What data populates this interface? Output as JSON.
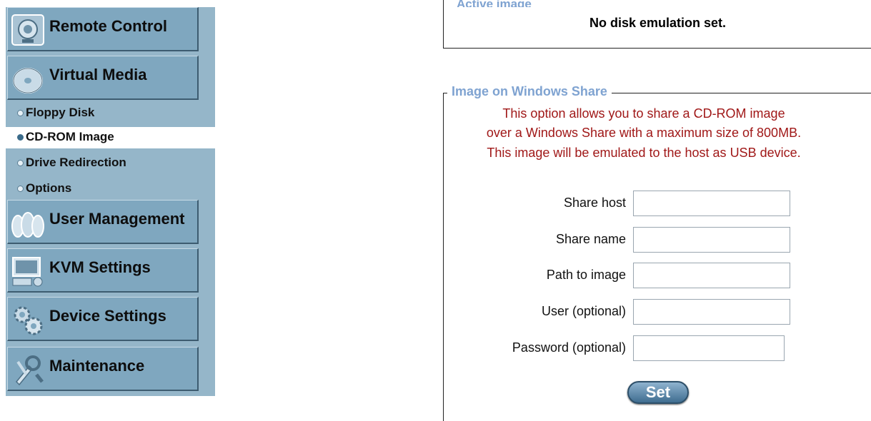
{
  "sidebar": {
    "nav": [
      {
        "label": "Remote Control",
        "icon": "monitor-icon"
      },
      {
        "label": "Virtual Media",
        "icon": "disc-icon"
      },
      {
        "label": "User Management",
        "icon": "users-icon"
      },
      {
        "label": "KVM Settings",
        "icon": "kvm-icon"
      },
      {
        "label": "Device Settings",
        "icon": "gears-icon"
      },
      {
        "label": "Maintenance",
        "icon": "tools-icon"
      }
    ],
    "sub_items": [
      {
        "label": "Floppy Disk"
      },
      {
        "label": "CD-ROM Image",
        "active": true
      },
      {
        "label": "Drive Redirection"
      },
      {
        "label": "Options"
      }
    ]
  },
  "active_image": {
    "legend": "Active image",
    "status": "No disk emulation set."
  },
  "share": {
    "legend": "Image on Windows Share",
    "info": [
      "This option allows you to share a CD-ROM image",
      "over a Windows Share with a maximum size of 800MB.",
      "This image will be emulated to the host as USB device."
    ],
    "fields": [
      {
        "label": "Share host",
        "value": ""
      },
      {
        "label": "Share name",
        "value": ""
      },
      {
        "label": "Path to image",
        "value": ""
      },
      {
        "label": "User (optional)",
        "value": ""
      },
      {
        "label": "Password (optional)",
        "value": ""
      }
    ],
    "set_label": "Set"
  },
  "colors": {
    "sidebar_bg": "#95b6c9",
    "button_bg": "#7fa7bf",
    "legend": "#7fa3d1",
    "info_text": "#a01818"
  }
}
